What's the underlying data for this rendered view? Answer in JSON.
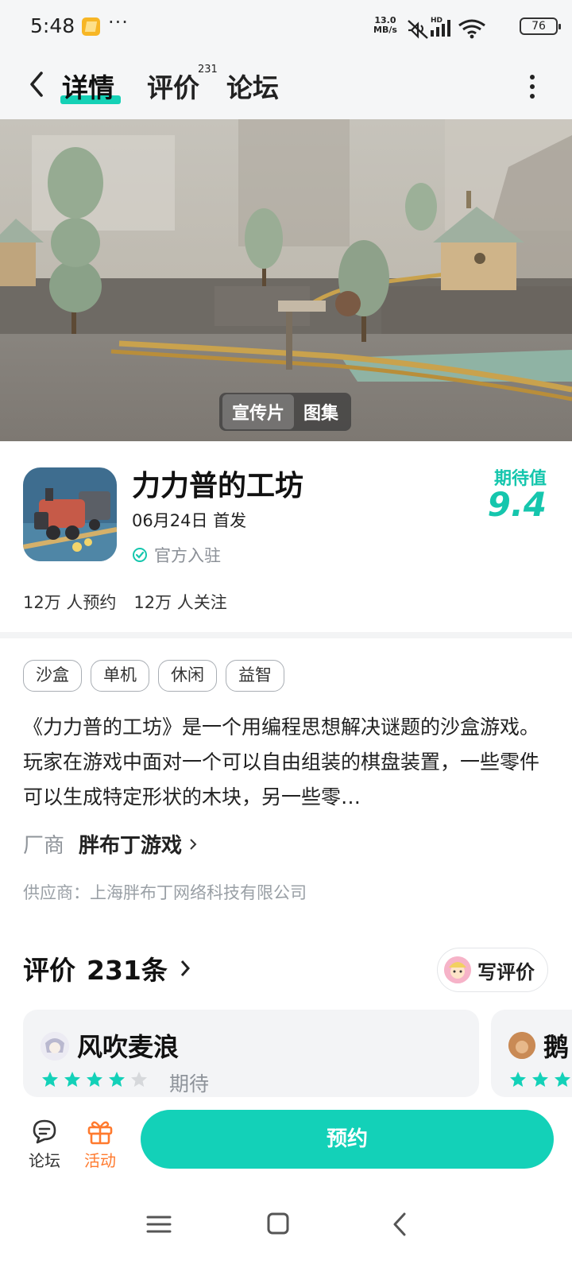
{
  "status_bar": {
    "time": "5:48",
    "dots": "···",
    "speed_value": "13.0",
    "speed_unit": "MB/s",
    "battery": "76"
  },
  "top_nav": {
    "tabs": [
      {
        "label": "详情",
        "active": true
      },
      {
        "label": "评价",
        "badge": "231"
      },
      {
        "label": "论坛"
      }
    ]
  },
  "banner": {
    "media_tabs": [
      "宣传片",
      "图集"
    ],
    "active_media": "宣传片"
  },
  "game": {
    "title": "力力普的工坊",
    "release": "06月24日 首发",
    "official": "官方入驻",
    "expect_label": "期待值",
    "expect_score": "9.4",
    "reservations": "12万 人预约",
    "followers": "12万 人关注"
  },
  "tags": [
    "沙盒",
    "单机",
    "休闲",
    "益智"
  ],
  "description": "《力力普的工坊》是一个用编程思想解决谜题的沙盒游戏。玩家在游戏中面对一个可以自由组装的棋盘装置，一些零件可以生成特定形状的木块，另一些零…",
  "vendor": {
    "label": "厂商",
    "name": "胖布丁游戏"
  },
  "supplier": "供应商：上海胖布丁网络科技有限公司",
  "reviews": {
    "title": "评价",
    "count": "231条",
    "write_label": "写评价",
    "items": [
      {
        "name": "风吹麦浪",
        "stars": 4,
        "state": "期待"
      },
      {
        "name": "鹅",
        "stars": 5
      }
    ]
  },
  "action_bar": {
    "forum_label": "论坛",
    "activity_label": "活动",
    "reserve_label": "预约"
  },
  "colors": {
    "accent": "#13d1b8",
    "activity": "#ff7a2e"
  }
}
